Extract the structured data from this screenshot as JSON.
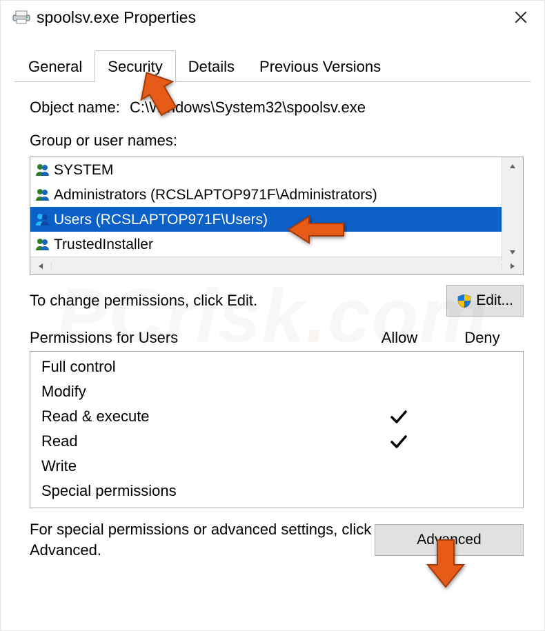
{
  "titlebar": {
    "title": "spoolsv.exe Properties"
  },
  "tabs": {
    "general": "General",
    "security": "Security",
    "details": "Details",
    "previous": "Previous Versions"
  },
  "object": {
    "label": "Object name:",
    "value": "C:\\Windows\\System32\\spoolsv.exe"
  },
  "groups": {
    "label": "Group or user names:",
    "items": [
      {
        "text": "SYSTEM"
      },
      {
        "text": "Administrators (RCSLAPTOP971F\\Administrators)"
      },
      {
        "text": "Users (RCSLAPTOP971F\\Users)"
      },
      {
        "text": "TrustedInstaller"
      }
    ]
  },
  "editrow": {
    "text": "To change permissions, click Edit.",
    "button": "Edit..."
  },
  "permissions": {
    "title": "Permissions for Users",
    "allow": "Allow",
    "deny": "Deny",
    "rows": [
      {
        "name": "Full control",
        "allow": "",
        "deny": ""
      },
      {
        "name": "Modify",
        "allow": "",
        "deny": ""
      },
      {
        "name": "Read & execute",
        "allow": "✓",
        "deny": ""
      },
      {
        "name": "Read",
        "allow": "✓",
        "deny": ""
      },
      {
        "name": "Write",
        "allow": "",
        "deny": ""
      },
      {
        "name": "Special permissions",
        "allow": "",
        "deny": ""
      }
    ]
  },
  "advanced": {
    "text": "For special permissions or advanced settings, click Advanced.",
    "button": "Advanced"
  },
  "icons": {
    "title_icon": "printer-icon",
    "close": "close-icon",
    "user_group": "users-icon",
    "shield": "uac-shield-icon",
    "check": "check-icon",
    "arrow_up": "caret-up-icon",
    "arrow_down": "caret-down-icon",
    "arrow_left": "caret-left-icon",
    "arrow_right": "caret-right-icon"
  },
  "colors": {
    "selection": "#0b61c7",
    "arrow_fill": "#e65b17",
    "arrow_stroke": "#a23b0a",
    "button_bg": "#e1e1e1"
  }
}
